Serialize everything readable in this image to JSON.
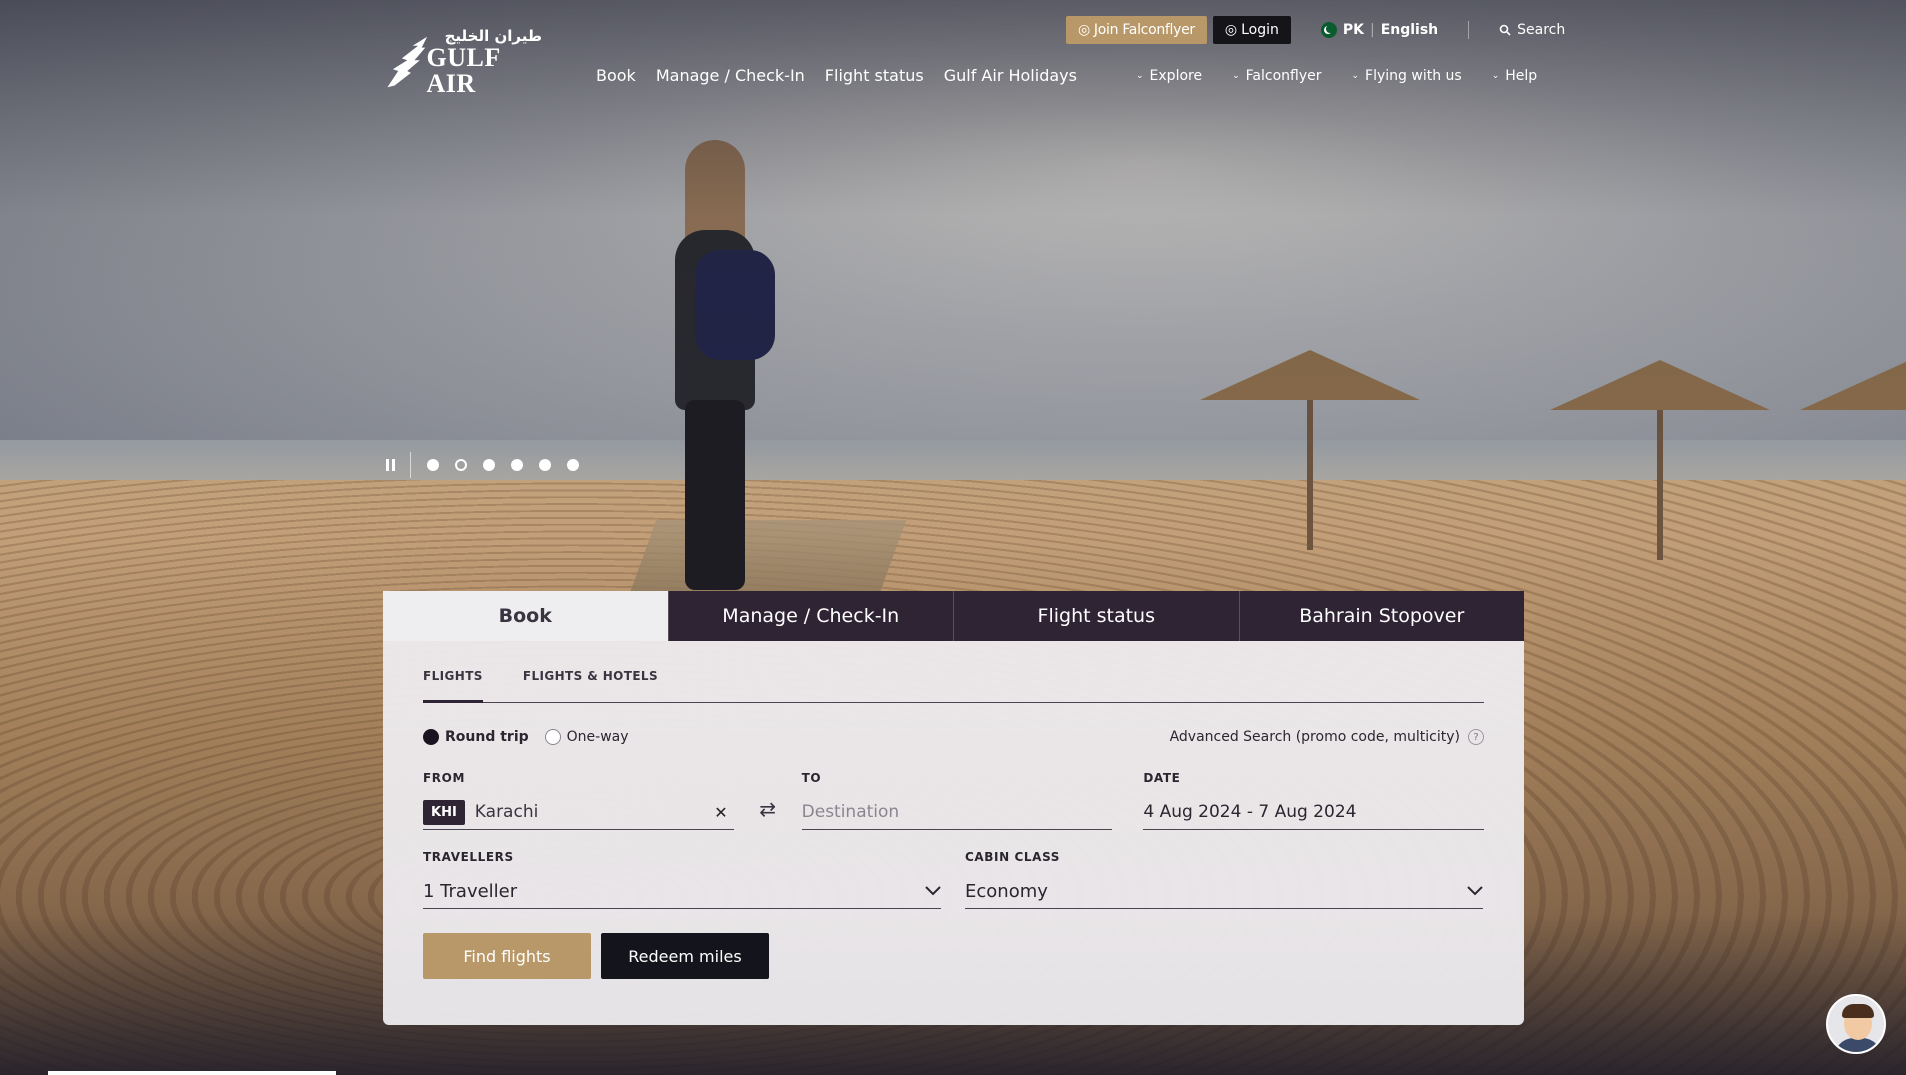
{
  "header": {
    "logo_arabic": "طيران الخليج",
    "logo_english": "GULF AIR",
    "join_label": "Join Falconflyer",
    "login_label": "Login",
    "country": "PK",
    "language": "English",
    "search_label": "Search"
  },
  "nav": {
    "primary": [
      "Book",
      "Manage / Check-In",
      "Flight status",
      "Gulf Air Holidays"
    ],
    "secondary": [
      "Explore",
      "Falconflyer",
      "Flying with us",
      "Help"
    ]
  },
  "carousel": {
    "slide_count": 6,
    "active_index": 1
  },
  "booking": {
    "tabs": [
      "Book",
      "Manage / Check-In",
      "Flight status",
      "Bahrain Stopover"
    ],
    "active_tab": 0,
    "subtabs": [
      "FLIGHTS",
      "FLIGHTS & HOTELS"
    ],
    "trip_types": [
      "Round trip",
      "One-way"
    ],
    "selected_trip": "Round trip",
    "advanced_search": "Advanced Search (promo code, multicity)",
    "from": {
      "label": "FROM",
      "code": "KHI",
      "city": "Karachi"
    },
    "to": {
      "label": "TO",
      "placeholder": "Destination"
    },
    "date": {
      "label": "DATE",
      "value": "4 Aug 2024 - 7 Aug 2024"
    },
    "travellers": {
      "label": "TRAVELLERS",
      "value": "1 Traveller"
    },
    "cabin": {
      "label": "CABIN CLASS",
      "value": "Economy"
    },
    "find_label": "Find flights",
    "redeem_label": "Redeem miles"
  },
  "colors": {
    "gold": "#b89868",
    "dark_plum": "#2e2434",
    "black": "#14141c"
  }
}
